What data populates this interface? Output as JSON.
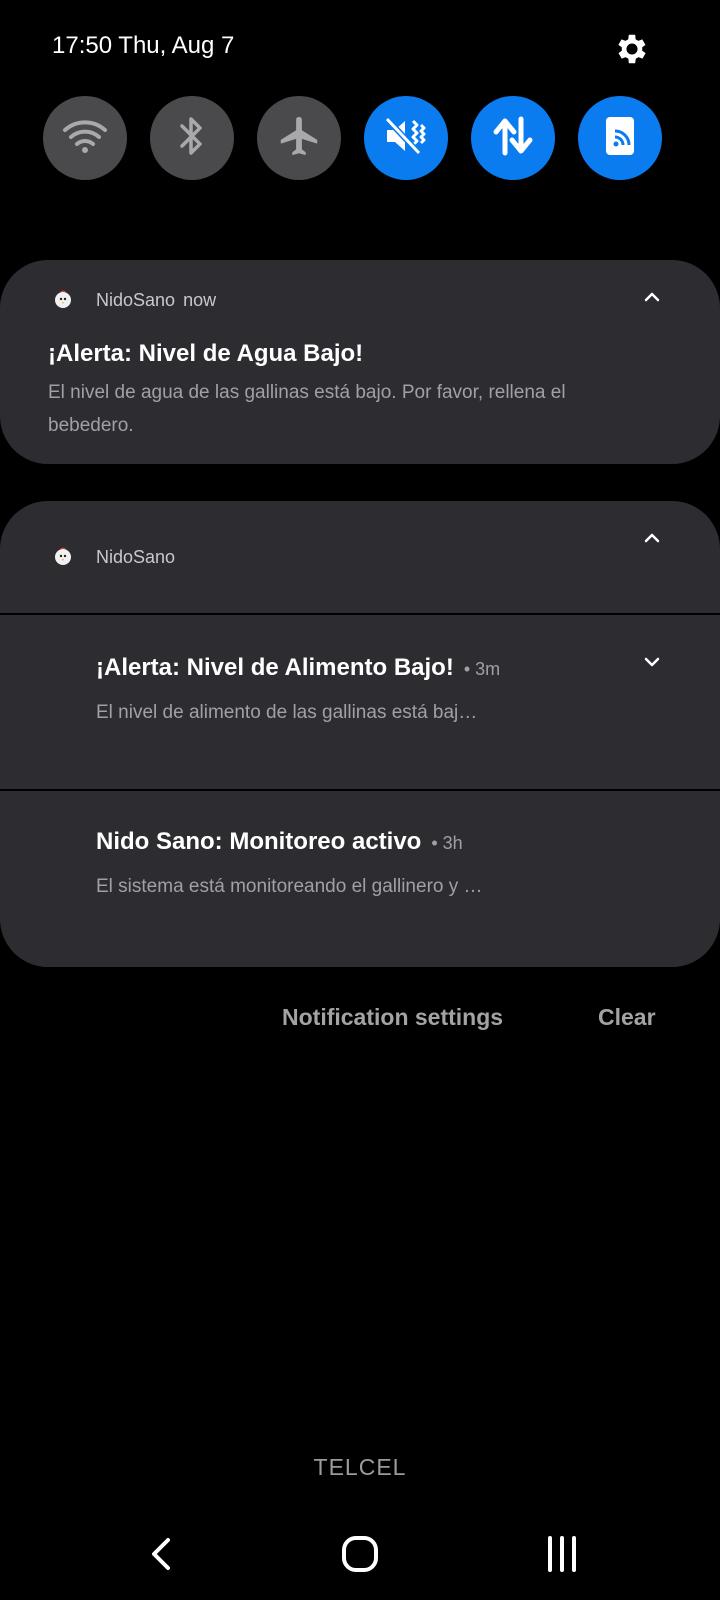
{
  "status_bar": {
    "time_date": "17:50  Thu, Aug 7"
  },
  "quick_settings": [
    {
      "name": "wifi",
      "icon": "wifi-icon",
      "active": false
    },
    {
      "name": "bluetooth",
      "icon": "bluetooth-icon",
      "active": false
    },
    {
      "name": "airplane",
      "icon": "airplane-icon",
      "active": false
    },
    {
      "name": "vibrate-mute",
      "icon": "mute-vibrate-icon",
      "active": true
    },
    {
      "name": "mobile-data",
      "icon": "data-arrows-icon",
      "active": true
    },
    {
      "name": "nfc",
      "icon": "nfc-icon",
      "active": true
    }
  ],
  "notifications": {
    "first": {
      "app": "NidoSano",
      "time": "now",
      "title": "¡Alerta: Nivel de Agua Bajo!",
      "body_line1": "El nivel de agua de las gallinas está bajo. Por favor, rellena el",
      "body_line2": "bebedero."
    },
    "group": {
      "app": "NidoSano",
      "items": [
        {
          "title": "¡Alerta: Nivel de Alimento Bajo!",
          "time": "• 3m",
          "body": "El nivel de alimento de las gallinas está baj…"
        },
        {
          "title": "Nido Sano: Monitoreo activo",
          "time": "• 3h",
          "body": "El sistema está monitoreando el gallinero y …"
        }
      ]
    }
  },
  "footer": {
    "settings_label": "Notification settings",
    "clear_label": "Clear"
  },
  "carrier": "TELCEL",
  "colors": {
    "accent": "#0a7cf0",
    "card": "#2d2d31",
    "inactive_toggle": "#4a4a4c"
  }
}
